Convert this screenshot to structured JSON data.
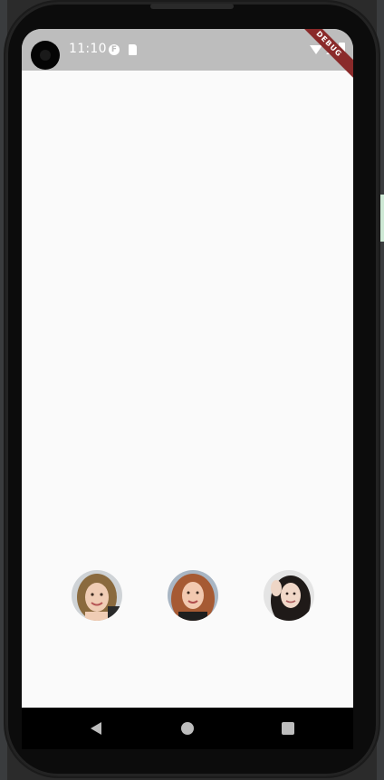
{
  "status_bar": {
    "time": "11:10",
    "debug_banner": "DEBUG"
  },
  "avatars": [
    {
      "name": "avatar-1"
    },
    {
      "name": "avatar-2"
    },
    {
      "name": "avatar-3"
    }
  ],
  "nav_bar": {
    "back_icon": "back-triangle",
    "home_icon": "home-circle",
    "recents_icon": "recents-square"
  },
  "colors": {
    "status_bar_bg": "#bdbdbd",
    "screen_bg": "#fafafa",
    "debug_banner": "#8a2a2a",
    "nav_bar_bg": "#000000"
  }
}
